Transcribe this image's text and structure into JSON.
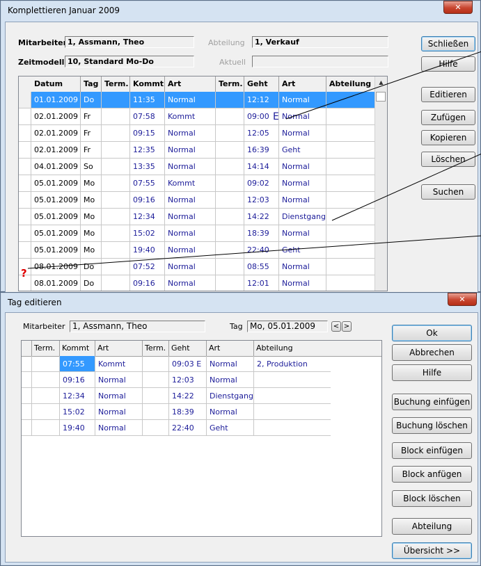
{
  "main_window": {
    "title": "Komplettieren Januar 2009",
    "mitarbeiter_label": "Mitarbeiter",
    "mitarbeiter_value": "1, Assmann, Theo",
    "abteilung_label": "Abteilung",
    "abteilung_value": "1, Verkauf",
    "zeitmodell_label": "Zeitmodell",
    "zeitmodell_value": "10, Standard Mo-Do",
    "aktuell_label": "Aktuell",
    "aktuell_value": "",
    "buttons": {
      "schliessen": "Schließen",
      "hilfe": "Hilfe",
      "editieren": "Editieren",
      "zufuegen": "Zufügen",
      "kopieren": "Kopieren",
      "loeschen": "Löschen",
      "suchen": "Suchen"
    },
    "columns": [
      "Datum",
      "Tag",
      "Term.",
      "Kommt",
      "Art",
      "Term.",
      "Geht",
      "Art",
      "Abteilung"
    ],
    "rows": [
      {
        "datum": "01.01.2009",
        "tag": "Do",
        "term1": "",
        "kommt": "11:35",
        "art1": "Normal",
        "term2": "",
        "geht": "12:12",
        "art2": "Normal",
        "abteilung": "",
        "selected": true
      },
      {
        "datum": "02.01.2009",
        "tag": "Fr",
        "term1": "",
        "kommt": "07:58",
        "art1": "Kommt",
        "term2": "",
        "geht": "09:00",
        "art2": "Normal",
        "abteilung": ""
      },
      {
        "datum": "02.01.2009",
        "tag": "Fr",
        "term1": "",
        "kommt": "09:15",
        "art1": "Normal",
        "term2": "",
        "geht": "12:05",
        "art2": "Normal",
        "abteilung": ""
      },
      {
        "datum": "02.01.2009",
        "tag": "Fr",
        "term1": "",
        "kommt": "12:35",
        "art1": "Normal",
        "term2": "",
        "geht": "16:39",
        "art2": "Geht",
        "abteilung": ""
      },
      {
        "datum": "04.01.2009",
        "tag": "So",
        "term1": "",
        "kommt": "13:35",
        "art1": "Normal",
        "term2": "",
        "geht": "14:14",
        "art2": "Normal",
        "abteilung": ""
      },
      {
        "datum": "05.01.2009",
        "tag": "Mo",
        "term1": "",
        "kommt": "07:55",
        "art1": "Kommt",
        "term2": "",
        "geht": "09:02",
        "art2": "Normal",
        "abteilung": ""
      },
      {
        "datum": "05.01.2009",
        "tag": "Mo",
        "term1": "",
        "kommt": "09:16",
        "art1": "Normal",
        "term2": "",
        "geht": "12:03",
        "art2": "Normal",
        "abteilung": ""
      },
      {
        "datum": "05.01.2009",
        "tag": "Mo",
        "term1": "",
        "kommt": "12:34",
        "art1": "Normal",
        "term2": "",
        "geht": "14:22",
        "art2": "Dienstgang",
        "abteilung": ""
      },
      {
        "datum": "05.01.2009",
        "tag": "Mo",
        "term1": "",
        "kommt": "15:02",
        "art1": "Normal",
        "term2": "",
        "geht": "18:39",
        "art2": "Normal",
        "abteilung": ""
      },
      {
        "datum": "05.01.2009",
        "tag": "Mo",
        "term1": "",
        "kommt": "19:40",
        "art1": "Normal",
        "term2": "",
        "geht": "22:40",
        "art2": "Geht",
        "abteilung": ""
      },
      {
        "datum": "08.01.2009",
        "tag": "Do",
        "term1": "",
        "kommt": "07:52",
        "art1": "Normal",
        "term2": "",
        "geht": "08:55",
        "art2": "Normal",
        "abteilung": ""
      },
      {
        "datum": "08.01.2009",
        "tag": "Do",
        "term1": "",
        "kommt": "09:16",
        "art1": "Normal",
        "term2": "",
        "geht": "12:01",
        "art2": "Normal",
        "abteilung": ""
      }
    ],
    "error_marker": "?",
    "edited_marker": "E"
  },
  "edit_window": {
    "title": "Tag editieren",
    "mitarbeiter_label": "Mitarbeiter",
    "mitarbeiter_value": "1, Assmann, Theo",
    "tag_label": "Tag",
    "tag_value": "Mo, 05.01.2009",
    "prev_label": "<",
    "next_label": ">",
    "columns": [
      "Term.",
      "Kommt",
      "Art",
      "Term.",
      "Geht",
      "Art",
      "Abteilung"
    ],
    "rows": [
      {
        "term1": "",
        "kommt": "07:55",
        "art1": "Kommt",
        "term2": "",
        "geht": "09:03 E",
        "art2": "Normal",
        "abteilung": "2, Produktion"
      },
      {
        "term1": "",
        "kommt": "09:16",
        "art1": "Normal",
        "term2": "",
        "geht": "12:03",
        "art2": "Normal",
        "abteilung": ""
      },
      {
        "term1": "",
        "kommt": "12:34",
        "art1": "Normal",
        "term2": "",
        "geht": "14:22",
        "art2": "Dienstgang",
        "abteilung": ""
      },
      {
        "term1": "",
        "kommt": "15:02",
        "art1": "Normal",
        "term2": "",
        "geht": "18:39",
        "art2": "Normal",
        "abteilung": ""
      },
      {
        "term1": "",
        "kommt": "19:40",
        "art1": "Normal",
        "term2": "",
        "geht": "22:40",
        "art2": "Geht",
        "abteilung": ""
      }
    ],
    "buttons": {
      "ok": "Ok",
      "abbrechen": "Abbrechen",
      "hilfe": "Hilfe",
      "buchung_einfuegen": "Buchung einfügen",
      "buchung_loeschen": "Buchung löschen",
      "block_einfuegen": "Block einfügen",
      "block_anfuegen": "Block anfügen",
      "block_loeschen": "Block löschen",
      "abteilung": "Abteilung",
      "uebersicht": "Übersicht >>"
    }
  },
  "colors": {
    "selection": "#3399ff",
    "data_text": "#1c1c99",
    "error_marker": "#e00000",
    "close_button": "#c8452f"
  }
}
